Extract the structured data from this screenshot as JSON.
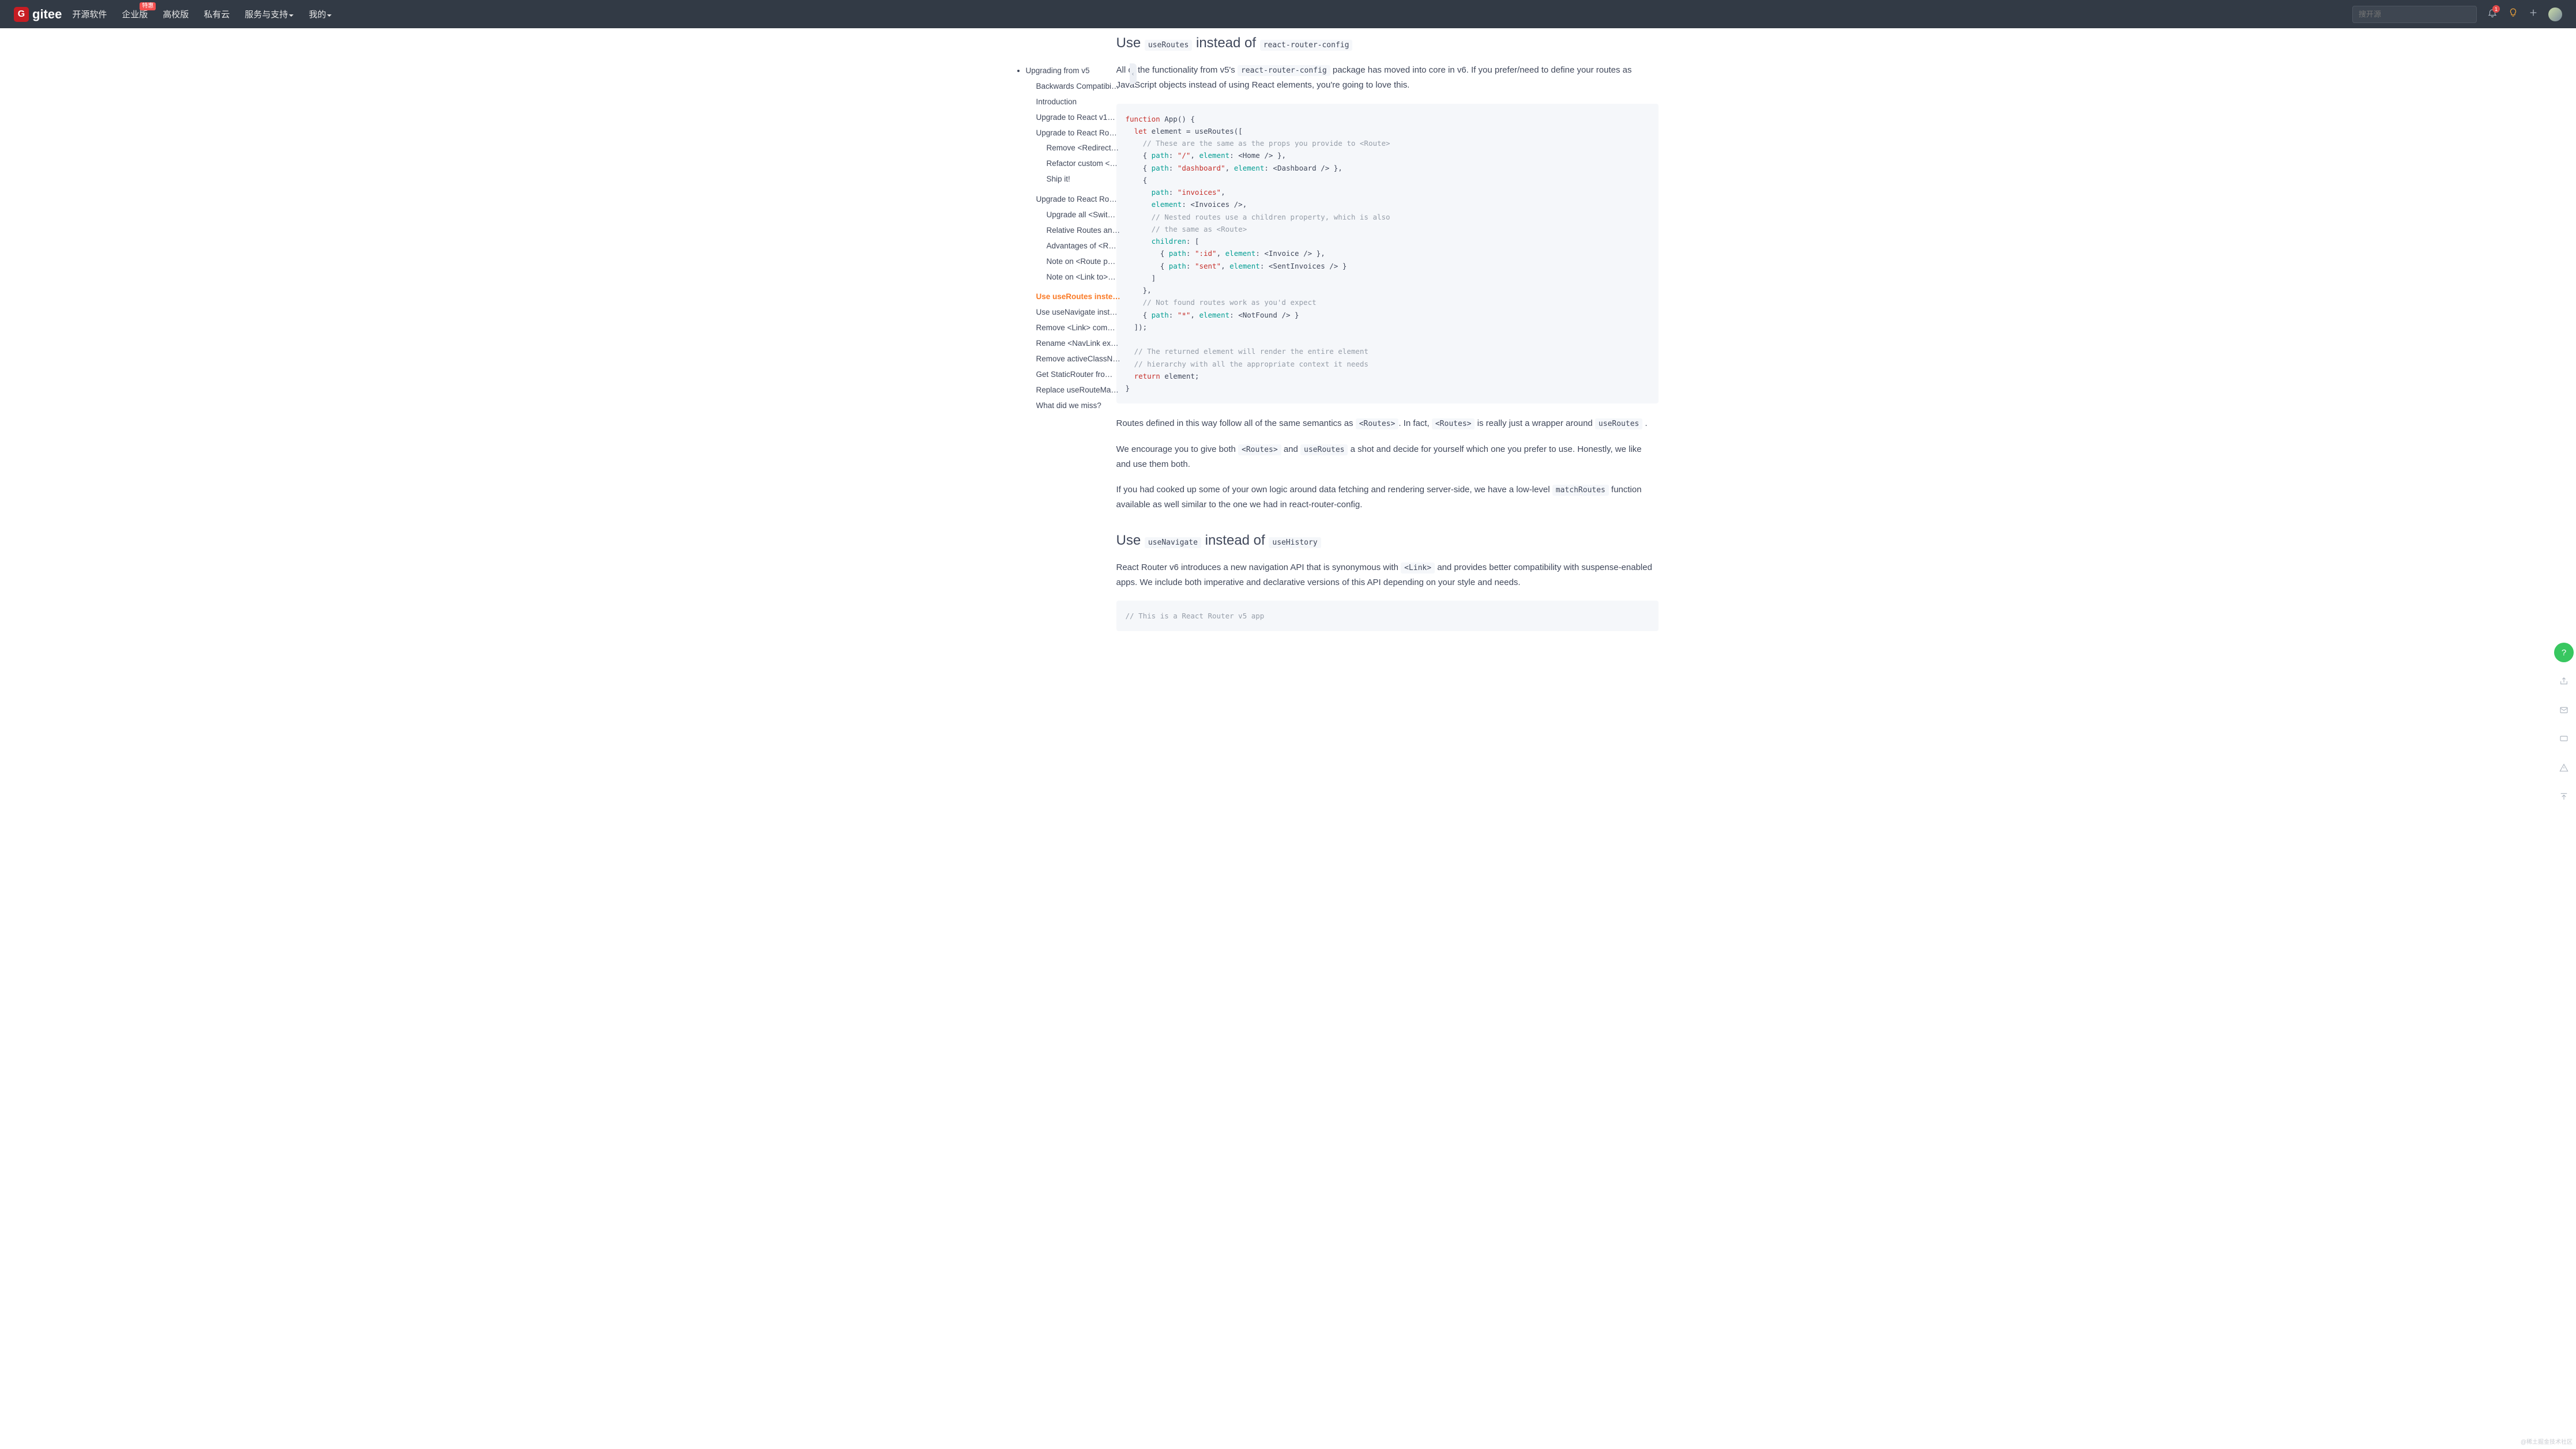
{
  "header": {
    "logo": "gitee",
    "nav": [
      "开源软件",
      "企业版",
      "高校版",
      "私有云",
      "服务与支持",
      "我的"
    ],
    "nav_badge": "特惠",
    "search_placeholder": "搜开源",
    "bell_count": "1"
  },
  "sidebar": {
    "root": "Upgrading from v5",
    "items": [
      "Backwards Compatibi…",
      "Introduction",
      "Upgrade to React v1…",
      "Upgrade to React Ro…"
    ],
    "sub_a": [
      "Remove <Redirect…",
      "Refactor custom <…",
      "Ship it!"
    ],
    "items2": [
      "Upgrade to React Ro…"
    ],
    "sub_b": [
      "Upgrade all <Swit…",
      "Relative Routes an…",
      "Advantages of <R…",
      "Note on <Route p…",
      "Note on <Link to>…"
    ],
    "items3": [
      "Use useRoutes inste…",
      "Use useNavigate inst…",
      "Remove <Link> com…",
      "Rename <NavLink ex…",
      "Remove activeClassN…",
      "Get StaticRouter fro…",
      "Replace useRouteMa…",
      "What did we miss?"
    ],
    "active_index": 0
  },
  "content": {
    "h1_pre": "Use ",
    "h1_code1": "useRoutes",
    "h1_mid": " instead of ",
    "h1_code2": "react-router-config",
    "p1_a": "All of the functionality from v5's ",
    "p1_code": "react-router-config",
    "p1_b": " package has moved into core in v6. If you prefer/need to define your routes as JavaScript objects instead of using React elements, you're going to love this.",
    "p2_a": "Routes defined in this way follow all of the same semantics as ",
    "p2_code1": "<Routes>",
    "p2_b": ". In fact, ",
    "p2_code2": "<Routes>",
    "p2_c": " is really just a wrapper around ",
    "p2_code3": "useRoutes",
    "p2_d": " .",
    "p3_a": "We encourage you to give both ",
    "p3_code1": "<Routes>",
    "p3_b": " and ",
    "p3_code2": "useRoutes",
    "p3_c": " a shot and decide for yourself which one you prefer to use. Honestly, we like and use them both.",
    "p4_a": "If you had cooked up some of your own logic around data fetching and rendering server-side, we have a low-level ",
    "p4_code": "matchRoutes",
    "p4_b": " function available as well similar to the one we had in react-router-config.",
    "h2_pre": "Use ",
    "h2_code1": "useNavigate",
    "h2_mid": " instead of ",
    "h2_code2": "useHistory",
    "p5": "React Router v6 introduces a new navigation API that is synonymous with ",
    "p5_code": "<Link>",
    "p5_b": " and provides better compatibility with suspense-enabled apps. We include both imperative and declarative versions of this API depending on your style and needs."
  },
  "watermark": "@稀土掘金技术社区"
}
